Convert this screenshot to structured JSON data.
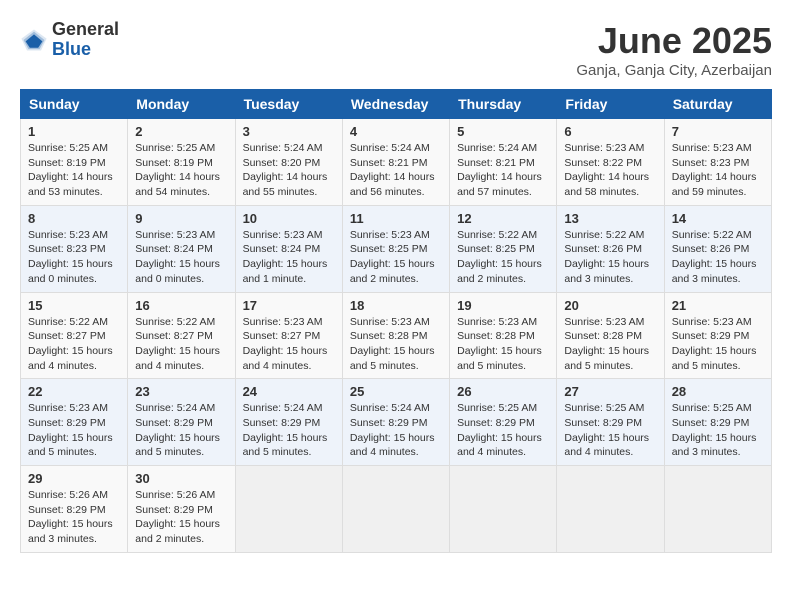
{
  "header": {
    "logo_general": "General",
    "logo_blue": "Blue",
    "month_title": "June 2025",
    "subtitle": "Ganja, Ganja City, Azerbaijan"
  },
  "days_of_week": [
    "Sunday",
    "Monday",
    "Tuesday",
    "Wednesday",
    "Thursday",
    "Friday",
    "Saturday"
  ],
  "weeks": [
    [
      {
        "day": "1",
        "sunrise": "5:25 AM",
        "sunset": "8:19 PM",
        "daylight": "14 hours and 53 minutes."
      },
      {
        "day": "2",
        "sunrise": "5:25 AM",
        "sunset": "8:19 PM",
        "daylight": "14 hours and 54 minutes."
      },
      {
        "day": "3",
        "sunrise": "5:24 AM",
        "sunset": "8:20 PM",
        "daylight": "14 hours and 55 minutes."
      },
      {
        "day": "4",
        "sunrise": "5:24 AM",
        "sunset": "8:21 PM",
        "daylight": "14 hours and 56 minutes."
      },
      {
        "day": "5",
        "sunrise": "5:24 AM",
        "sunset": "8:21 PM",
        "daylight": "14 hours and 57 minutes."
      },
      {
        "day": "6",
        "sunrise": "5:23 AM",
        "sunset": "8:22 PM",
        "daylight": "14 hours and 58 minutes."
      },
      {
        "day": "7",
        "sunrise": "5:23 AM",
        "sunset": "8:23 PM",
        "daylight": "14 hours and 59 minutes."
      }
    ],
    [
      {
        "day": "8",
        "sunrise": "5:23 AM",
        "sunset": "8:23 PM",
        "daylight": "15 hours and 0 minutes."
      },
      {
        "day": "9",
        "sunrise": "5:23 AM",
        "sunset": "8:24 PM",
        "daylight": "15 hours and 0 minutes."
      },
      {
        "day": "10",
        "sunrise": "5:23 AM",
        "sunset": "8:24 PM",
        "daylight": "15 hours and 1 minute."
      },
      {
        "day": "11",
        "sunrise": "5:23 AM",
        "sunset": "8:25 PM",
        "daylight": "15 hours and 2 minutes."
      },
      {
        "day": "12",
        "sunrise": "5:22 AM",
        "sunset": "8:25 PM",
        "daylight": "15 hours and 2 minutes."
      },
      {
        "day": "13",
        "sunrise": "5:22 AM",
        "sunset": "8:26 PM",
        "daylight": "15 hours and 3 minutes."
      },
      {
        "day": "14",
        "sunrise": "5:22 AM",
        "sunset": "8:26 PM",
        "daylight": "15 hours and 3 minutes."
      }
    ],
    [
      {
        "day": "15",
        "sunrise": "5:22 AM",
        "sunset": "8:27 PM",
        "daylight": "15 hours and 4 minutes."
      },
      {
        "day": "16",
        "sunrise": "5:22 AM",
        "sunset": "8:27 PM",
        "daylight": "15 hours and 4 minutes."
      },
      {
        "day": "17",
        "sunrise": "5:23 AM",
        "sunset": "8:27 PM",
        "daylight": "15 hours and 4 minutes."
      },
      {
        "day": "18",
        "sunrise": "5:23 AM",
        "sunset": "8:28 PM",
        "daylight": "15 hours and 5 minutes."
      },
      {
        "day": "19",
        "sunrise": "5:23 AM",
        "sunset": "8:28 PM",
        "daylight": "15 hours and 5 minutes."
      },
      {
        "day": "20",
        "sunrise": "5:23 AM",
        "sunset": "8:28 PM",
        "daylight": "15 hours and 5 minutes."
      },
      {
        "day": "21",
        "sunrise": "5:23 AM",
        "sunset": "8:29 PM",
        "daylight": "15 hours and 5 minutes."
      }
    ],
    [
      {
        "day": "22",
        "sunrise": "5:23 AM",
        "sunset": "8:29 PM",
        "daylight": "15 hours and 5 minutes."
      },
      {
        "day": "23",
        "sunrise": "5:24 AM",
        "sunset": "8:29 PM",
        "daylight": "15 hours and 5 minutes."
      },
      {
        "day": "24",
        "sunrise": "5:24 AM",
        "sunset": "8:29 PM",
        "daylight": "15 hours and 5 minutes."
      },
      {
        "day": "25",
        "sunrise": "5:24 AM",
        "sunset": "8:29 PM",
        "daylight": "15 hours and 4 minutes."
      },
      {
        "day": "26",
        "sunrise": "5:25 AM",
        "sunset": "8:29 PM",
        "daylight": "15 hours and 4 minutes."
      },
      {
        "day": "27",
        "sunrise": "5:25 AM",
        "sunset": "8:29 PM",
        "daylight": "15 hours and 4 minutes."
      },
      {
        "day": "28",
        "sunrise": "5:25 AM",
        "sunset": "8:29 PM",
        "daylight": "15 hours and 3 minutes."
      }
    ],
    [
      {
        "day": "29",
        "sunrise": "5:26 AM",
        "sunset": "8:29 PM",
        "daylight": "15 hours and 3 minutes."
      },
      {
        "day": "30",
        "sunrise": "5:26 AM",
        "sunset": "8:29 PM",
        "daylight": "15 hours and 2 minutes."
      },
      null,
      null,
      null,
      null,
      null
    ]
  ]
}
